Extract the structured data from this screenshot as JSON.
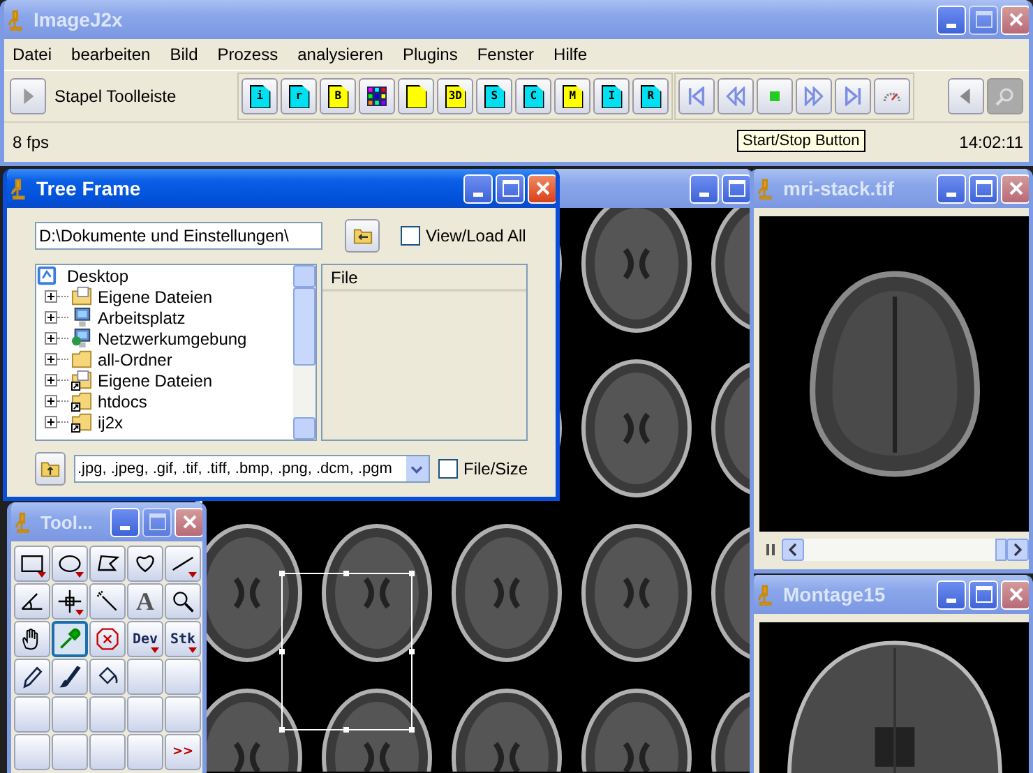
{
  "main_window": {
    "title": "ImageJ2x",
    "active": false,
    "menu": [
      "Datei",
      "bearbeiten",
      "Bild",
      "Prozess",
      "analysieren",
      "Plugins",
      "Fenster",
      "Hilfe"
    ],
    "toolbar": {
      "toggle_label": "Stapel Toolleiste",
      "stack_buttons": [
        {
          "kind": "doc",
          "label": "i",
          "color": "#00e0f0"
        },
        {
          "kind": "doc",
          "label": "r",
          "color": "#00e0f0"
        },
        {
          "kind": "doc",
          "label": "B",
          "color": "#ffff00"
        },
        {
          "kind": "grid"
        },
        {
          "kind": "doc",
          "color": "#ffff00"
        },
        {
          "kind": "doc",
          "label": "3D",
          "color": "#ffff00"
        },
        {
          "kind": "doc",
          "label": "S",
          "color": "#00e0f0"
        },
        {
          "kind": "doc",
          "label": "C",
          "color": "#00e0f0"
        },
        {
          "kind": "doc",
          "label": "M",
          "color": "#ffff00"
        },
        {
          "kind": "doc",
          "label": "I",
          "color": "#00e0f0"
        },
        {
          "kind": "doc",
          "label": "R",
          "color": "#00e0f0"
        }
      ],
      "player_buttons": [
        {
          "kind": "first"
        },
        {
          "kind": "rewind"
        },
        {
          "kind": "stop"
        },
        {
          "kind": "forward"
        },
        {
          "kind": "last"
        },
        {
          "kind": "gauge"
        }
      ],
      "end_buttons": [
        {
          "kind": "back",
          "disabled": false
        },
        {
          "kind": "search",
          "disabled": true
        }
      ]
    },
    "status": {
      "fps": "8 fps",
      "tooltip": "Start/Stop Button",
      "time": "14:02:11"
    }
  },
  "background_window": {
    "active": false
  },
  "tree_frame": {
    "title": "Tree Frame",
    "active": true,
    "path_value": "D:\\Dokumente und Einstellungen\\",
    "view_load_all": {
      "label": "View/Load All",
      "checked": false
    },
    "tree": [
      {
        "label": "Desktop",
        "children": [
          {
            "label": "Eigene Dateien",
            "kind": "documents",
            "shortcut": false,
            "expanded": false
          },
          {
            "label": "Arbeitsplatz",
            "kind": "computer",
            "shortcut": false,
            "expanded": false
          },
          {
            "label": "Netzwerkumgebung",
            "kind": "network",
            "shortcut": false,
            "expanded": false
          },
          {
            "label": "all-Ordner",
            "kind": "folder",
            "shortcut": false,
            "expanded": false
          },
          {
            "label": "Eigene Dateien",
            "kind": "documents",
            "shortcut": true,
            "expanded": false
          },
          {
            "label": "htdocs",
            "kind": "folder",
            "shortcut": true,
            "expanded": false
          },
          {
            "label": "ij2x",
            "kind": "folder",
            "shortcut": true,
            "expanded": false
          }
        ]
      }
    ],
    "file_column": "File",
    "filter_value": ".jpg, .jpeg, .gif, .tif, .tiff, .bmp, .png, .dcm, .pgm",
    "file_size": {
      "label": "File/Size",
      "checked": false
    }
  },
  "tools_window": {
    "title": "Tool...",
    "active": false,
    "tools": [
      {
        "kind": "rectangle",
        "menu": true,
        "selected": false
      },
      {
        "kind": "oval",
        "menu": true,
        "selected": false
      },
      {
        "kind": "polygon",
        "menu": false,
        "selected": false
      },
      {
        "kind": "freehand",
        "menu": false,
        "selected": false
      },
      {
        "kind": "line",
        "menu": true,
        "selected": false
      },
      {
        "kind": "angle",
        "menu": false,
        "selected": false
      },
      {
        "kind": "point",
        "menu": true,
        "selected": false
      },
      {
        "kind": "wand",
        "menu": false,
        "selected": false
      },
      {
        "kind": "glyph",
        "label": "A",
        "menu": false,
        "selected": false
      },
      {
        "kind": "magnifier",
        "menu": false,
        "selected": false
      },
      {
        "kind": "hand",
        "menu": false,
        "selected": false
      },
      {
        "kind": "dropper",
        "menu": false,
        "selected": true
      },
      {
        "kind": "stop",
        "menu": false,
        "selected": false
      },
      {
        "kind": "label",
        "label": "Dev",
        "menu": true,
        "selected": false
      },
      {
        "kind": "label",
        "label": "Stk",
        "menu": true,
        "selected": false
      },
      {
        "kind": "pencil",
        "menu": false,
        "selected": false
      },
      {
        "kind": "brush",
        "menu": false,
        "selected": false
      },
      {
        "kind": "fill",
        "menu": false,
        "selected": false
      },
      {
        "kind": "empty",
        "menu": false,
        "selected": false
      },
      {
        "kind": "empty",
        "menu": false,
        "selected": false
      },
      {
        "kind": "empty",
        "menu": false,
        "selected": false
      },
      {
        "kind": "empty",
        "menu": false,
        "selected": false
      },
      {
        "kind": "empty",
        "menu": false,
        "selected": false
      },
      {
        "kind": "empty",
        "menu": false,
        "selected": false
      },
      {
        "kind": "empty",
        "menu": false,
        "selected": false
      },
      {
        "kind": "empty",
        "menu": false,
        "selected": false
      },
      {
        "kind": "empty",
        "menu": false,
        "selected": false
      },
      {
        "kind": "empty",
        "menu": false,
        "selected": false
      },
      {
        "kind": "empty",
        "menu": false,
        "selected": false
      },
      {
        "kind": "more",
        "label": ">>",
        "menu": false,
        "selected": false
      }
    ]
  },
  "stack_window": {
    "title": "mri-stack.tif",
    "active": false,
    "slider": {
      "level": 1
    }
  },
  "montage_window": {
    "title": "Montage15",
    "active": false
  }
}
